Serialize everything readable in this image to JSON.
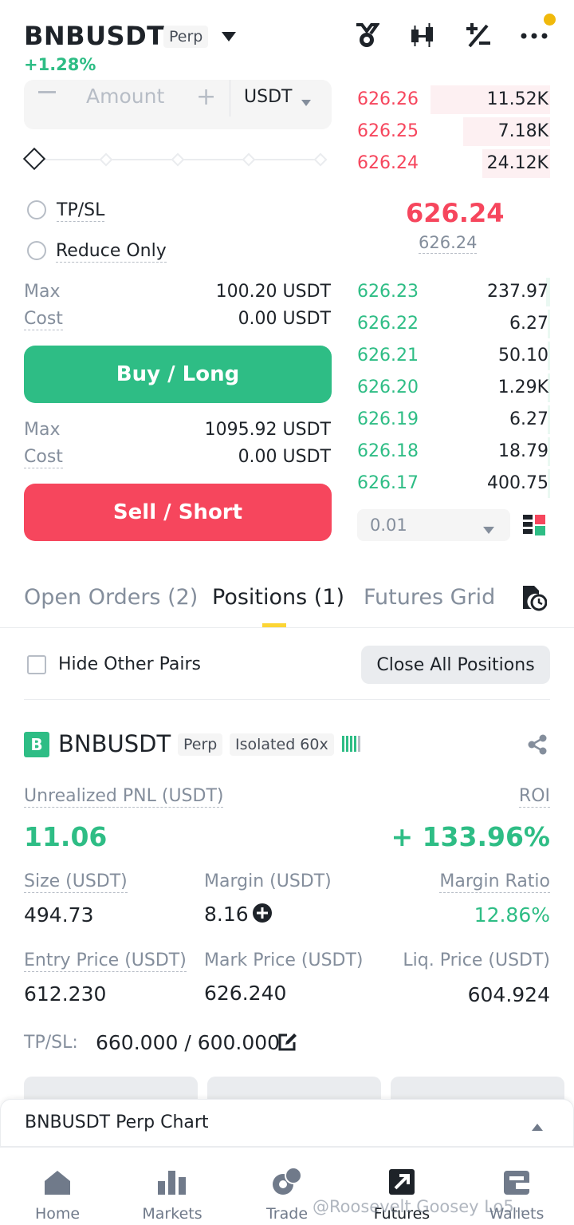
{
  "header": {
    "symbol": "BNBUSDT",
    "contract_tag": "Perp",
    "change": "+1.28%"
  },
  "order_form": {
    "amount_placeholder": "Amount",
    "unit": "USDT",
    "tp_sl_label": "TP/SL",
    "reduce_only_label": "Reduce Only",
    "buy": {
      "max_label": "Max",
      "max_value": "100.20 USDT",
      "cost_label": "Cost",
      "cost_value": "0.00 USDT",
      "button": "Buy / Long"
    },
    "sell": {
      "max_label": "Max",
      "max_value": "1095.92 USDT",
      "cost_label": "Cost",
      "cost_value": "0.00 USDT",
      "button": "Sell / Short"
    }
  },
  "order_book": {
    "asks": [
      {
        "price": "626.26",
        "qty": "11.52K",
        "depth": 0.62
      },
      {
        "price": "626.25",
        "qty": "7.18K",
        "depth": 0.45
      },
      {
        "price": "626.24",
        "qty": "24.12K",
        "depth": 0.35
      }
    ],
    "last_price": "626.24",
    "mark_price": "626.24",
    "bids": [
      {
        "price": "626.23",
        "qty": "237.97",
        "depth": 0.02
      },
      {
        "price": "626.22",
        "qty": "6.27",
        "depth": 0.01
      },
      {
        "price": "626.21",
        "qty": "50.10",
        "depth": 0.01
      },
      {
        "price": "626.20",
        "qty": "1.29K",
        "depth": 0.01
      },
      {
        "price": "626.19",
        "qty": "6.27",
        "depth": 0.01
      },
      {
        "price": "626.18",
        "qty": "18.79",
        "depth": 0.01
      },
      {
        "price": "626.17",
        "qty": "400.75",
        "depth": 0.01
      }
    ],
    "precision": "0.01"
  },
  "tabs": {
    "open_orders": "Open Orders (2)",
    "positions": "Positions (1)",
    "futures_grid": "Futures Grid"
  },
  "positions": {
    "hide_other_pairs": "Hide Other Pairs",
    "close_all": "Close All Positions",
    "card": {
      "side_badge": "B",
      "symbol": "BNBUSDT",
      "contract_tag": "Perp",
      "margin_mode": "Isolated 60x",
      "unrealized_pnl_label": "Unrealized PNL (USDT)",
      "unrealized_pnl": "11.06",
      "roi_label": "ROI",
      "roi": "+ 133.96%",
      "size_label": "Size (USDT)",
      "size": "494.73",
      "margin_label": "Margin (USDT)",
      "margin": "8.16",
      "margin_ratio_label": "Margin Ratio",
      "margin_ratio": "12.86%",
      "entry_price_label": "Entry Price (USDT)",
      "entry_price": "612.230",
      "mark_price_label": "Mark Price (USDT)",
      "mark_price": "626.240",
      "liq_price_label": "Liq. Price (USDT)",
      "liq_price": "604.924",
      "tp_sl_label": "TP/SL:",
      "tp_sl_value": "660.000 / 600.000"
    }
  },
  "chart_bar": {
    "label": "BNBUSDT Perp Chart"
  },
  "nav": {
    "home": "Home",
    "markets": "Markets",
    "trade": "Trade",
    "futures": "Futures",
    "wallets": "Wallets",
    "watermark": "@Roosevelt Goosey Lo5..."
  },
  "colors": {
    "green": "#2ebd85",
    "red": "#f6465d",
    "yellow": "#fcd535",
    "text": "#1e2329",
    "muted": "#848e9c"
  }
}
